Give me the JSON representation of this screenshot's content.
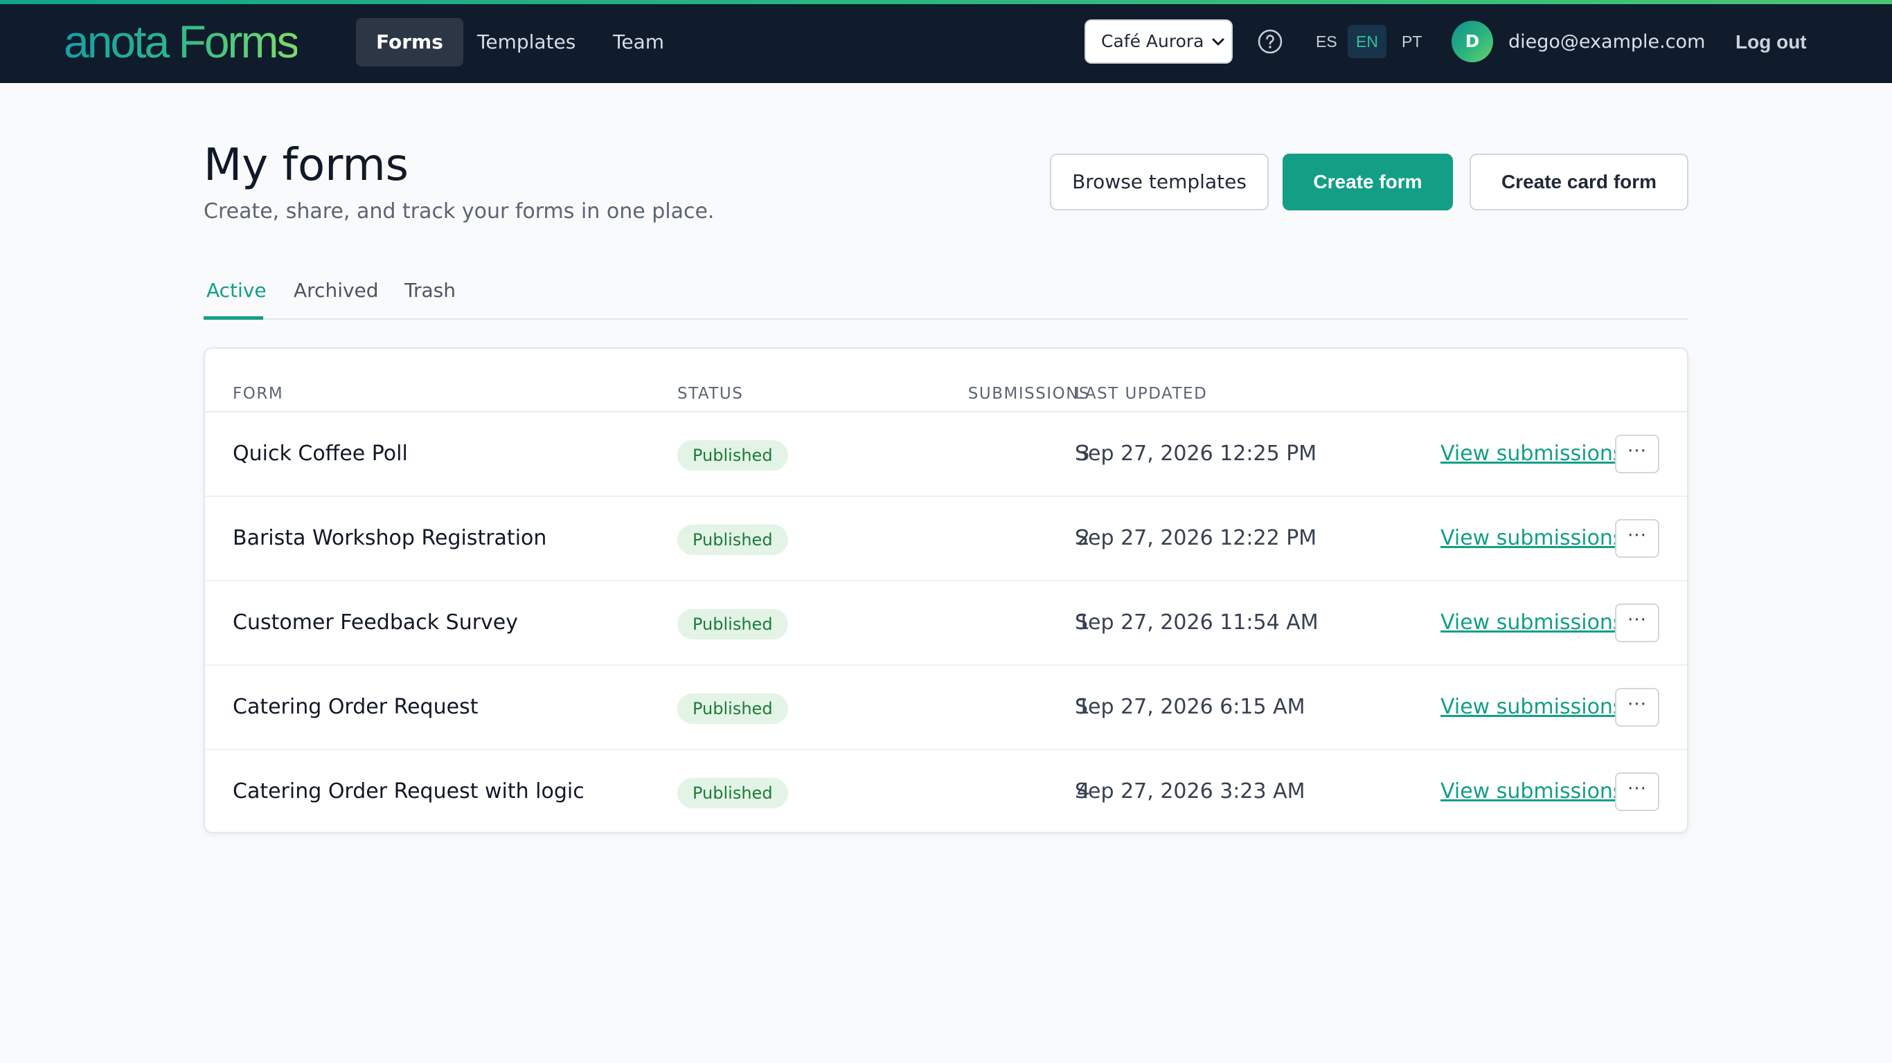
{
  "app": {
    "logo": "anota Forms",
    "nav": [
      {
        "label": "Forms",
        "active": true
      },
      {
        "label": "Templates",
        "active": false
      },
      {
        "label": "Team",
        "active": false
      }
    ],
    "workspace_select": "Café Aurora",
    "help_icon": "question-circle-icon",
    "languages": [
      {
        "code": "ES",
        "active": false
      },
      {
        "code": "EN",
        "active": true
      },
      {
        "code": "PT",
        "active": false
      }
    ],
    "user": {
      "initial": "D",
      "email": "diego@example.com"
    },
    "logout_label": "Log out",
    "colors": {
      "topbar": "#101c2c",
      "accent": "#139f86",
      "badge_bg": "#e3f4e6",
      "badge_text": "#1e7a3a"
    }
  },
  "page": {
    "title": "My forms",
    "subtitle": "Create, share, and track your forms in one place.",
    "buttons": {
      "browse_templates": "Browse templates",
      "create_form": "Create form",
      "create_card_form": "Create card form"
    },
    "tabs": [
      {
        "label": "Active",
        "active": true
      },
      {
        "label": "Archived",
        "active": false
      },
      {
        "label": "Trash",
        "active": false
      }
    ]
  },
  "table": {
    "columns": {
      "form": "FORM",
      "status": "STATUS",
      "submissions": "SUBMISSIONS",
      "last_updated": "LAST UPDATED"
    },
    "rows": [
      {
        "name": "Quick Coffee Poll",
        "status": "Published",
        "submissions": "3",
        "updated": "Sep 27, 2026 12:25 PM",
        "action": "View submissions",
        "more": "···"
      },
      {
        "name": "Barista Workshop Registration",
        "status": "Published",
        "submissions": "2",
        "updated": "Sep 27, 2026 12:22 PM",
        "action": "View submissions",
        "more": "···"
      },
      {
        "name": "Customer Feedback Survey",
        "status": "Published",
        "submissions": "1",
        "updated": "Sep 27, 2026 11:54 AM",
        "action": "View submissions",
        "more": "···"
      },
      {
        "name": "Catering Order Request",
        "status": "Published",
        "submissions": "1",
        "updated": "Sep 27, 2026 6:15 AM",
        "action": "View submissions",
        "more": "···"
      },
      {
        "name": "Catering Order Request with logic",
        "status": "Published",
        "submissions": "4",
        "updated": "Sep 27, 2026 3:23 AM",
        "action": "View submissions",
        "more": "···"
      }
    ]
  }
}
